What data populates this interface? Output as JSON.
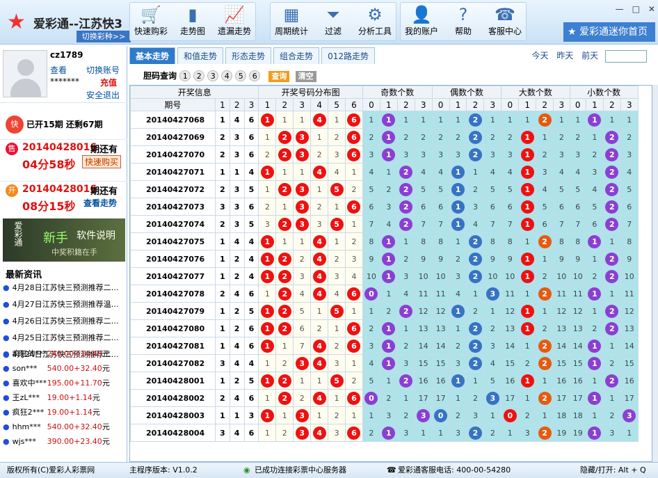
{
  "app": {
    "title": "爱彩通--江苏快3",
    "switch_label": "切换彩种>>",
    "mini_home": "爱彩通迷你首页"
  },
  "toolbar": [
    {
      "label": "快速购彩",
      "icon": "cart-icon",
      "glyph": "🛒"
    },
    {
      "label": "走势图",
      "icon": "bar-chart-icon",
      "glyph": "▮"
    },
    {
      "label": "遗漏走势",
      "icon": "line-chart-icon",
      "glyph": "📈"
    },
    {
      "label": "周期统计",
      "icon": "table-icon",
      "glyph": "▦"
    },
    {
      "label": "过滤",
      "icon": "funnel-icon",
      "glyph": "⏷"
    },
    {
      "label": "分析工具",
      "icon": "gear-icon",
      "glyph": "⚙"
    },
    {
      "label": "我的账户",
      "icon": "account-icon",
      "glyph": "👤"
    },
    {
      "label": "帮助",
      "icon": "help-icon",
      "glyph": "?"
    },
    {
      "label": "客服中心",
      "icon": "support-icon",
      "glyph": "☎"
    }
  ],
  "user": {
    "name": "cz1789",
    "view": "查看",
    "switch_account": "切换账号",
    "password": "*******",
    "recharge": "充值",
    "logout": "安全退出"
  },
  "lottery": {
    "status": "已开15期 还剩67期",
    "sell": {
      "badge": "售",
      "issue": "20140428016",
      "suffix": "期还有",
      "countdown": "04分58秒",
      "button": "快速购买"
    },
    "open": {
      "badge": "开",
      "issue": "20140428016",
      "suffix": "期还有",
      "countdown": "08分15秒",
      "button": "查看走势"
    }
  },
  "banner": {
    "t1": "爱彩通",
    "t2": "新手",
    "t3": "软件说明",
    "t4": "中奖积籍在手"
  },
  "news": {
    "title": "最新资讯",
    "items": [
      "4月28日江苏快三预测推荐二…",
      "4月27日江苏快三预测推荐温…",
      "4月26日江苏快三预测推荐二…",
      "4月25日江苏快三预测推荐二…",
      "4月24日江苏快三预测推荐二…"
    ]
  },
  "winners": [
    {
      "user": "疯狂的***",
      "amt": "240.00+14.40",
      "unit": "元"
    },
    {
      "user": "son***",
      "amt": "540.00+32.40",
      "unit": "元"
    },
    {
      "user": "喜欢中***",
      "amt": "195.00+11.70",
      "unit": "元"
    },
    {
      "user": "王zL***",
      "amt": "19.00+1.14",
      "unit": "元"
    },
    {
      "user": "疯狂2***",
      "amt": "19.00+1.14",
      "unit": "元"
    },
    {
      "user": "hhm***",
      "amt": "540.00+32.40",
      "unit": "元"
    },
    {
      "user": "wjs***",
      "amt": "390.00+23.40",
      "unit": "元"
    }
  ],
  "tabs": [
    "基本走势",
    "和值走势",
    "形态走势",
    "组合走势",
    "012路走势"
  ],
  "days": {
    "today": "今天",
    "yesterday": "昨天",
    "before": "前天"
  },
  "filter": {
    "label": "胆码查询",
    "nums": [
      "1",
      "2",
      "3",
      "4",
      "5",
      "6"
    ],
    "query": "查询",
    "clear": "清空"
  },
  "headers": {
    "info": "开奖信息",
    "dist": "开奖号码分布图",
    "odd": "奇数个数",
    "even": "偶数个数",
    "big": "大数个数",
    "small": "小数个数",
    "period": "期号"
  },
  "rows": [
    {
      "p": "20140427068",
      "n": [
        1,
        4,
        6
      ],
      "odd": 1,
      "even": 2,
      "big": 2,
      "small": 1
    },
    {
      "p": "20140427069",
      "n": [
        2,
        3,
        6
      ],
      "odd": 1,
      "even": 2,
      "big": 1,
      "small": 2
    },
    {
      "p": "20140427070",
      "n": [
        2,
        3,
        6
      ],
      "odd": 1,
      "even": 2,
      "big": 1,
      "small": 2
    },
    {
      "p": "20140427071",
      "n": [
        1,
        1,
        4
      ],
      "odd": 2,
      "even": 1,
      "big": 1,
      "small": 2
    },
    {
      "p": "20140427072",
      "n": [
        2,
        3,
        5
      ],
      "odd": 2,
      "even": 1,
      "big": 1,
      "small": 2
    },
    {
      "p": "20140427073",
      "n": [
        3,
        3,
        6
      ],
      "odd": 2,
      "even": 1,
      "big": 1,
      "small": 2
    },
    {
      "p": "20140427074",
      "n": [
        2,
        3,
        5
      ],
      "odd": 2,
      "even": 1,
      "big": 1,
      "small": 2
    },
    {
      "p": "20140427075",
      "n": [
        1,
        4,
        4
      ],
      "odd": 1,
      "even": 2,
      "big": 2,
      "small": 1
    },
    {
      "p": "20140427076",
      "n": [
        1,
        2,
        4
      ],
      "odd": 1,
      "even": 2,
      "big": 1,
      "small": 2
    },
    {
      "p": "20140427077",
      "n": [
        1,
        2,
        4
      ],
      "odd": 1,
      "even": 2,
      "big": 1,
      "small": 2
    },
    {
      "p": "20140427078",
      "n": [
        2,
        4,
        6
      ],
      "odd": 0,
      "even": 3,
      "big": 2,
      "small": 1
    },
    {
      "p": "20140427079",
      "n": [
        1,
        2,
        5
      ],
      "odd": 2,
      "even": 1,
      "big": 1,
      "small": 2
    },
    {
      "p": "20140427080",
      "n": [
        1,
        2,
        6
      ],
      "odd": 1,
      "even": 2,
      "big": 1,
      "small": 2
    },
    {
      "p": "20140427081",
      "n": [
        1,
        4,
        6
      ],
      "odd": 1,
      "even": 2,
      "big": 2,
      "small": 1
    },
    {
      "p": "20140427082",
      "n": [
        3,
        4,
        4
      ],
      "odd": 1,
      "even": 2,
      "big": 2,
      "small": 1
    },
    {
      "p": "20140428001",
      "n": [
        1,
        2,
        5
      ],
      "odd": 2,
      "even": 1,
      "big": 1,
      "small": 2
    },
    {
      "p": "20140428002",
      "n": [
        2,
        4,
        6
      ],
      "odd": 0,
      "even": 3,
      "big": 2,
      "small": 1
    },
    {
      "p": "20140428003",
      "n": [
        1,
        1,
        3
      ],
      "odd": 3,
      "even": 0,
      "big": 0,
      "small": 3
    },
    {
      "p": "20140428004",
      "n": [
        3,
        4,
        6
      ],
      "odd": 1,
      "even": 2,
      "big": 2,
      "small": 1
    }
  ],
  "status": {
    "copyright": "版权所有(C)爱彩人彩票网",
    "version": "主程序版本: V1.0.2",
    "server": "已成功连接彩票中心服务器",
    "hotline": "爱彩通客服电话: 400-00-54280",
    "hide": "隐藏/打开: Alt + Q"
  }
}
